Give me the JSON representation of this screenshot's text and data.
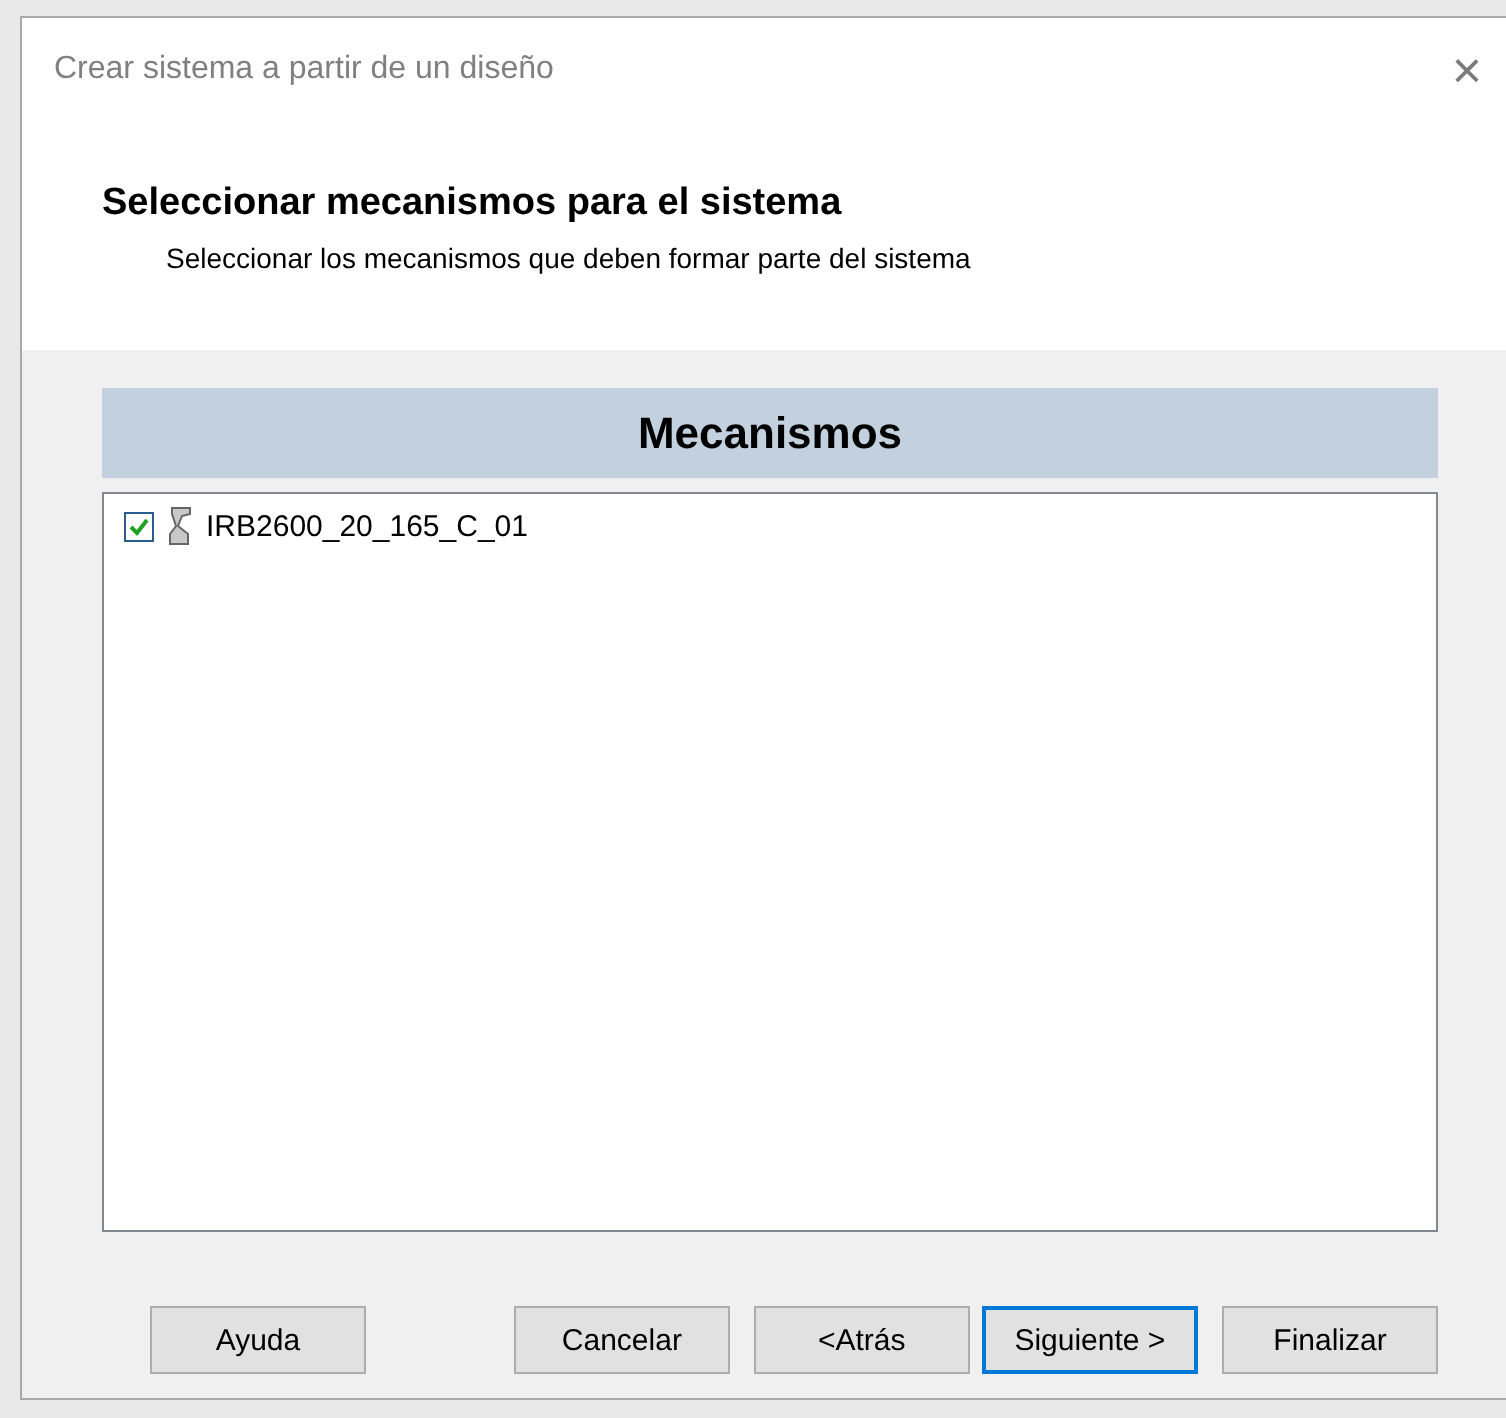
{
  "window": {
    "title": "Crear sistema a partir de un diseño",
    "close": "×"
  },
  "header": {
    "title": "Seleccionar mecanismos para el sistema",
    "subtitle": "Seleccionar los mecanismos que deben formar parte del sistema"
  },
  "list": {
    "heading": "Mecanismos",
    "items": [
      {
        "label": "IRB2600_20_165_C_01",
        "checked": true
      }
    ]
  },
  "buttons": [
    {
      "label": "Ayuda",
      "focused": false
    },
    {
      "label": "Cancelar",
      "focused": false
    },
    {
      "label": "<Atrás",
      "focused": false
    },
    {
      "label": "Siguiente >",
      "focused": true
    },
    {
      "label": "Finalizar",
      "focused": false
    }
  ]
}
